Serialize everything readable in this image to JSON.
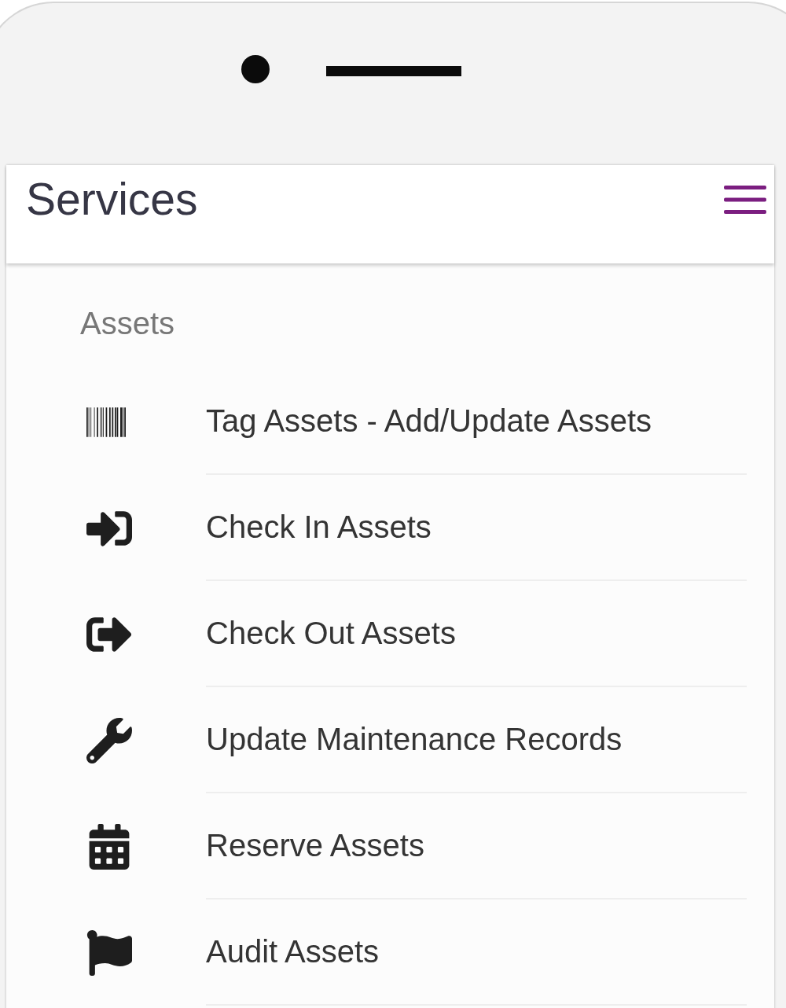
{
  "header": {
    "title": "Services"
  },
  "section": {
    "label": "Assets"
  },
  "items": [
    {
      "label": "Tag Assets - Add/Update Assets"
    },
    {
      "label": "Check In Assets"
    },
    {
      "label": "Check Out Assets"
    },
    {
      "label": "Update Maintenance Records"
    },
    {
      "label": "Reserve Assets"
    },
    {
      "label": "Audit Assets"
    }
  ]
}
